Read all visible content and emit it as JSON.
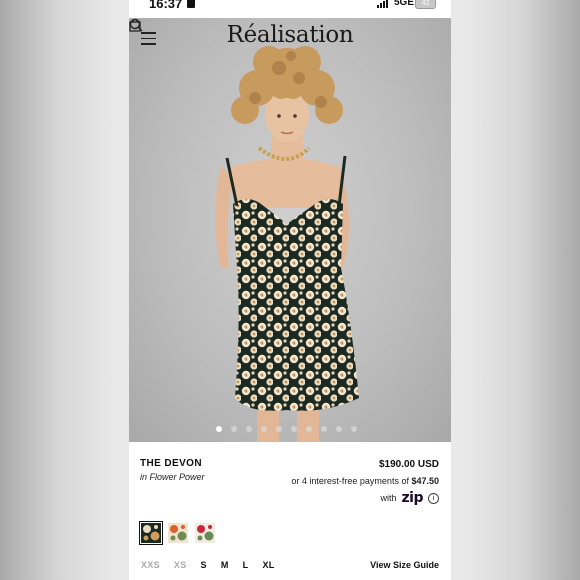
{
  "status_bar": {
    "time": "16:37",
    "network": "5GE",
    "battery": "42"
  },
  "header": {
    "brand": "Réalisation"
  },
  "gallery": {
    "dot_count": 10,
    "active_index": 0
  },
  "product": {
    "name": "THE DEVON",
    "color": "in Flower Power",
    "price": "$190.00 USD",
    "installment_text": "or 4 interest-free payments of",
    "installment_amount": "$47.50",
    "with_text": "with",
    "payment_brand": "zip",
    "info_symbol": "i"
  },
  "swatches": [
    {
      "name": "Flower Power",
      "colors": [
        "#1c2b22",
        "#e9dcc2",
        "#d49a5b"
      ],
      "selected": true
    },
    {
      "name": "Orange Floral",
      "colors": [
        "#f0e3d2",
        "#d9602a",
        "#6e8c4b"
      ],
      "selected": false
    },
    {
      "name": "Rose Print",
      "colors": [
        "#f3ece2",
        "#c8283b",
        "#6a8a55"
      ],
      "selected": false
    }
  ],
  "sizes": [
    {
      "label": "XXS",
      "available": false
    },
    {
      "label": "XS",
      "available": false
    },
    {
      "label": "S",
      "available": true
    },
    {
      "label": "M",
      "available": true
    },
    {
      "label": "L",
      "available": true
    },
    {
      "label": "XL",
      "available": true
    }
  ],
  "size_guide_label": "View Size Guide"
}
